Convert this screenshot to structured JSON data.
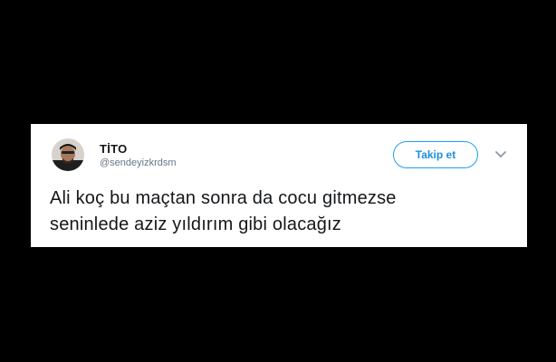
{
  "tweet": {
    "author_name": "TİTO",
    "author_handle": "@sendeyizkrdsm",
    "follow_label": "Takip et",
    "text_line_1": "Ali koç bu maçtan sonra da cocu gitmezse",
    "text_line_2": "seninlede aziz yıldırım gibi olacağız"
  },
  "icons": {
    "avatar": "profile-photo",
    "menu": "chevron-down-icon"
  },
  "colors": {
    "background": "#000000",
    "card": "#ffffff",
    "accent": "#1da1f2",
    "text": "#14171a",
    "muted": "#657786"
  }
}
